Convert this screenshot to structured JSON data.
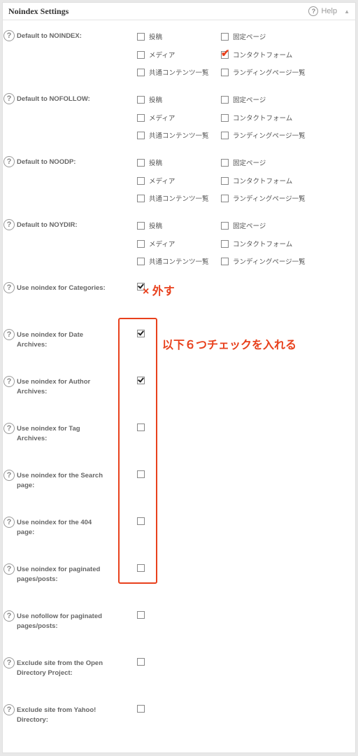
{
  "panel": {
    "title": "Noindex Settings",
    "help_label": "Help",
    "collapse_glyph": "▲"
  },
  "options": {
    "post": "投稿",
    "page": "固定ページ",
    "media": "メディア",
    "contact": "コンタクトフォーム",
    "common": "共通コンテンツ一覧",
    "landing": "ランディングページ一覧"
  },
  "defaults": [
    {
      "label": "Default to NOINDEX:",
      "checked": {
        "post": false,
        "page": false,
        "media": false,
        "contact": true,
        "common": false,
        "landing": false
      }
    },
    {
      "label": "Default to NOFOLLOW:",
      "checked": {
        "post": false,
        "page": false,
        "media": false,
        "contact": false,
        "common": false,
        "landing": false
      }
    },
    {
      "label": "Default to NOODP:",
      "checked": {
        "post": false,
        "page": false,
        "media": false,
        "contact": false,
        "common": false,
        "landing": false
      }
    },
    {
      "label": "Default to NOYDIR:",
      "checked": {
        "post": false,
        "page": false,
        "media": false,
        "contact": false,
        "common": false,
        "landing": false
      }
    }
  ],
  "settings": [
    {
      "line1": "Use noindex for Categories:",
      "line2": "",
      "checked": true
    },
    {
      "line1": "Use noindex for Date",
      "line2": "Archives:",
      "checked": true
    },
    {
      "line1": "Use noindex for Author",
      "line2": "Archives:",
      "checked": true
    },
    {
      "line1": "Use noindex for Tag",
      "line2": "Archives:",
      "checked": false
    },
    {
      "line1": "Use noindex for the Search",
      "line2": "page:",
      "checked": false
    },
    {
      "line1": "Use noindex for the 404",
      "line2": "page:",
      "checked": false
    },
    {
      "line1": "Use noindex for paginated",
      "line2": "pages/posts:",
      "checked": false
    },
    {
      "line1": "Use nofollow for paginated",
      "line2": "pages/posts:",
      "checked": false
    },
    {
      "line1": "Exclude site from the Open",
      "line2": "Directory Project:",
      "checked": false
    },
    {
      "line1": "Exclude site from Yahoo!",
      "line2": "Directory:",
      "checked": false
    }
  ],
  "annotations": {
    "remove_note": "× 外す",
    "check_note": "以下６つチェックを入れる",
    "color": "#e8401c"
  },
  "icons": {
    "help": "question-circle-icon",
    "check": "check-mark-icon",
    "collapse": "triangle-up-icon"
  }
}
